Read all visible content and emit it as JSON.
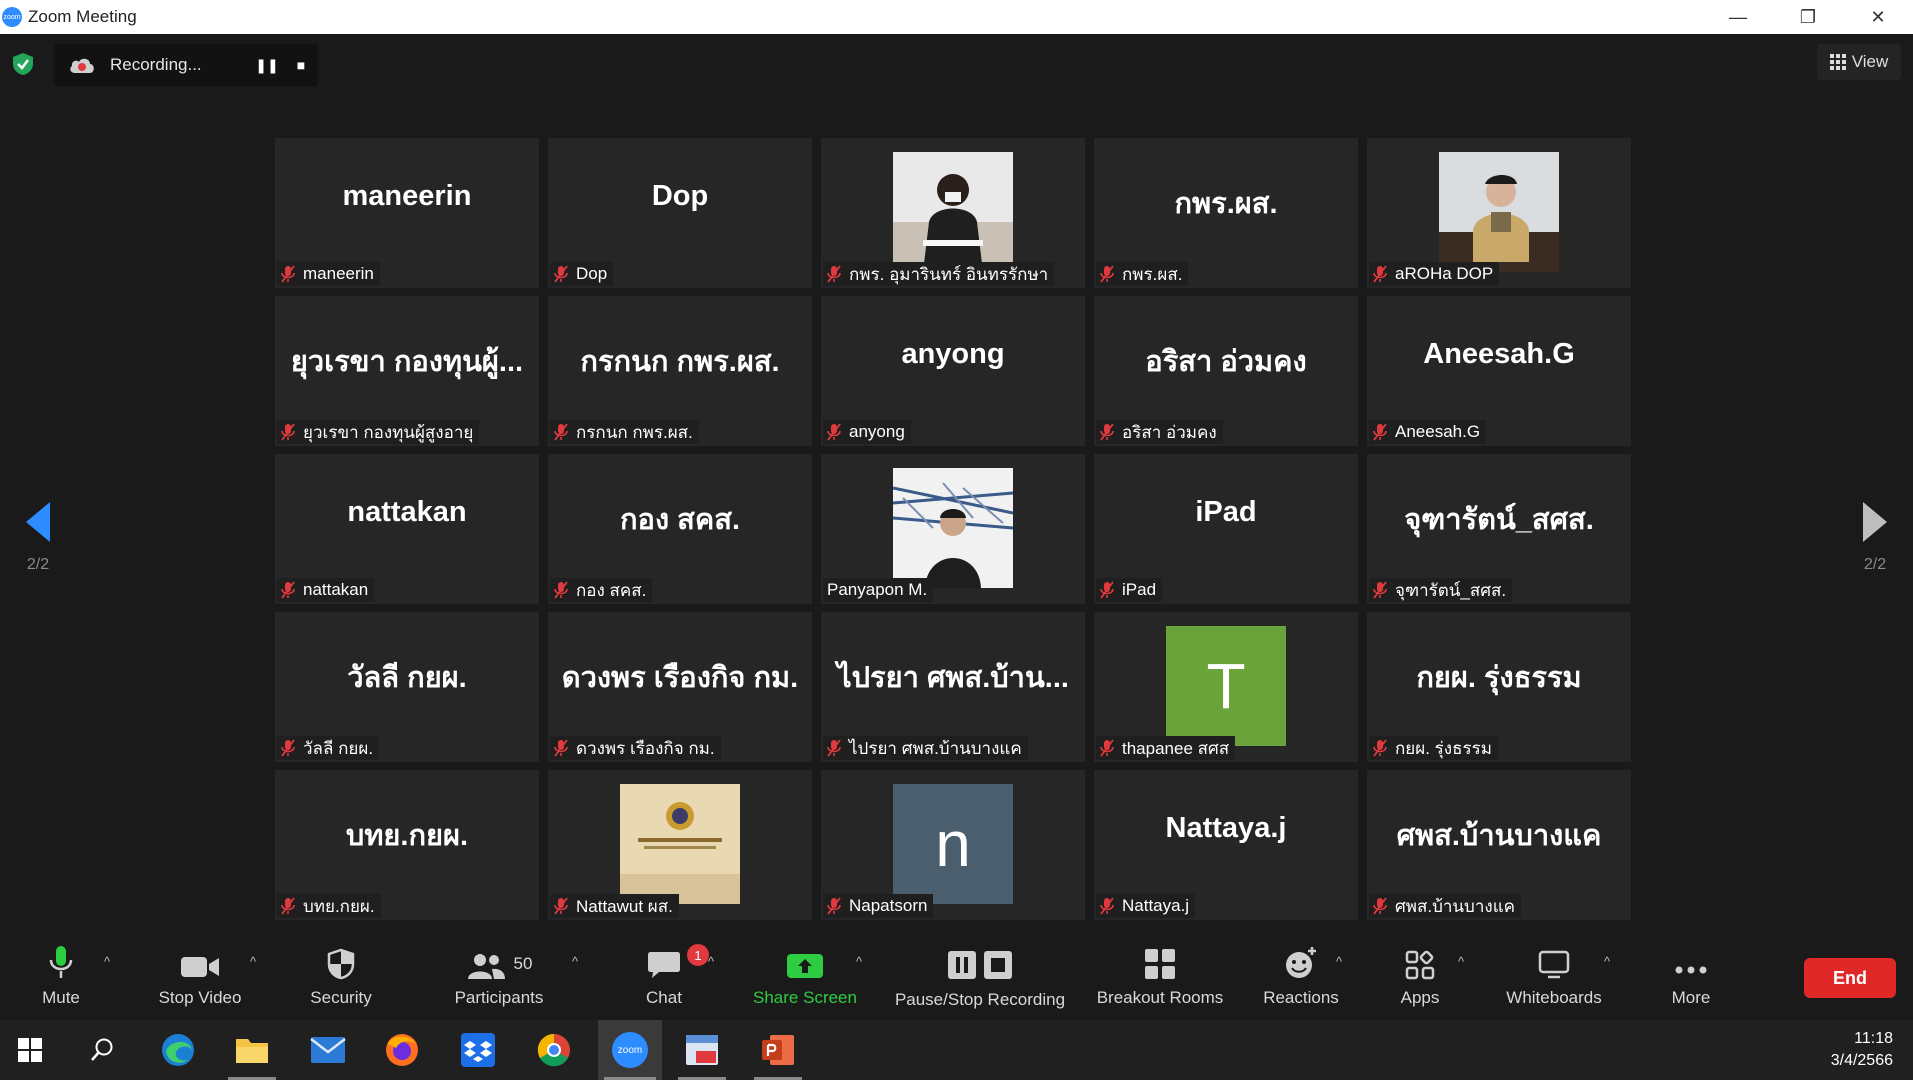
{
  "window": {
    "logo_text": "zoom",
    "title": "Zoom Meeting",
    "minimize": "—",
    "restore": "❐",
    "close": "✕"
  },
  "recording": {
    "label": "Recording...",
    "pause_glyph": "❚❚",
    "stop_glyph": "■"
  },
  "view": {
    "label": "View"
  },
  "pages": {
    "left": "2/2",
    "right": "2/2"
  },
  "tiles": [
    {
      "name": "maneerin",
      "label": "maneerin",
      "muted": true
    },
    {
      "name": "Dop",
      "label": "Dop",
      "muted": true
    },
    {
      "name": "",
      "label": "กพร. อุมารินทร์ อินทรรักษา",
      "muted": true
    },
    {
      "name": "กพร.ผส.",
      "label": "กพร.ผส.",
      "muted": true
    },
    {
      "name": "",
      "label": "aROHa DOP",
      "muted": true
    },
    {
      "name": "ยุวเรขา กองทุนผู้...",
      "label": "ยุวเรขา กองทุนผู้สูงอายุ",
      "muted": true
    },
    {
      "name": "กรกนก กพร.ผส.",
      "label": "กรกนก กพร.ผส.",
      "muted": true
    },
    {
      "name": "anyong",
      "label": "anyong",
      "muted": true
    },
    {
      "name": "อริสา อ่วมคง",
      "label": "อริสา อ่วมคง",
      "muted": true
    },
    {
      "name": "Aneesah.G",
      "label": "Aneesah.G",
      "muted": true
    },
    {
      "name": "nattakan",
      "label": "nattakan",
      "muted": true
    },
    {
      "name": "กอง สคส.",
      "label": "กอง สคส.",
      "muted": true
    },
    {
      "name": "",
      "label": "Panyapon M.",
      "muted": false
    },
    {
      "name": "iPad",
      "label": "iPad",
      "muted": true
    },
    {
      "name": "จุฑารัตน์_สศส.",
      "label": "จุฑารัตน์_สศส.",
      "muted": true
    },
    {
      "name": "วัลลี กยผ.",
      "label": "วัลลี กยผ.",
      "muted": true
    },
    {
      "name": "ดวงพร เรืองกิจ กม.",
      "label": "ดวงพร เรืองกิจ กม.",
      "muted": true
    },
    {
      "name": "ไปรยา ศพส.บ้าน...",
      "label": "ไปรยา ศพส.บ้านบางแค",
      "muted": true
    },
    {
      "name": "",
      "label": "thapanee สศส",
      "muted": true,
      "avatar_letter": "T",
      "avatar_color": "#6aa33a"
    },
    {
      "name": "กยผ. รุ่งธรรม",
      "label": "กยผ. รุ่งธรรม",
      "muted": true
    },
    {
      "name": "บทย.กยผ.",
      "label": "บทย.กยผ.",
      "muted": true
    },
    {
      "name": "",
      "label": "Nattawut ผส.",
      "muted": true
    },
    {
      "name": "",
      "label": "Napatsorn",
      "muted": true,
      "avatar_letter": "n",
      "avatar_color": "#4a5e6e"
    },
    {
      "name": "Nattaya.j",
      "label": "Nattaya.j",
      "muted": true
    },
    {
      "name": "ศพส.บ้านบางแค",
      "label": "ศพส.บ้านบางแค",
      "muted": true
    }
  ],
  "toolbar": {
    "mute": "Mute",
    "stop_video": "Stop Video",
    "security": "Security",
    "participants": "Participants",
    "participants_count": "50",
    "chat": "Chat",
    "chat_badge": "1",
    "share_screen": "Share Screen",
    "pause_stop_recording": "Pause/Stop Recording",
    "breakout_rooms": "Breakout Rooms",
    "reactions": "Reactions",
    "apps": "Apps",
    "whiteboards": "Whiteboards",
    "more": "More",
    "end": "End",
    "caret": "^"
  },
  "colors": {
    "share_green": "#2ecc40",
    "end_red": "#e02828",
    "accent_blue": "#2d8cff",
    "mute_red": "#e0393e"
  },
  "taskbar": {
    "zoom_text": "zoom",
    "time": "11:18",
    "date": "3/4/2566"
  }
}
